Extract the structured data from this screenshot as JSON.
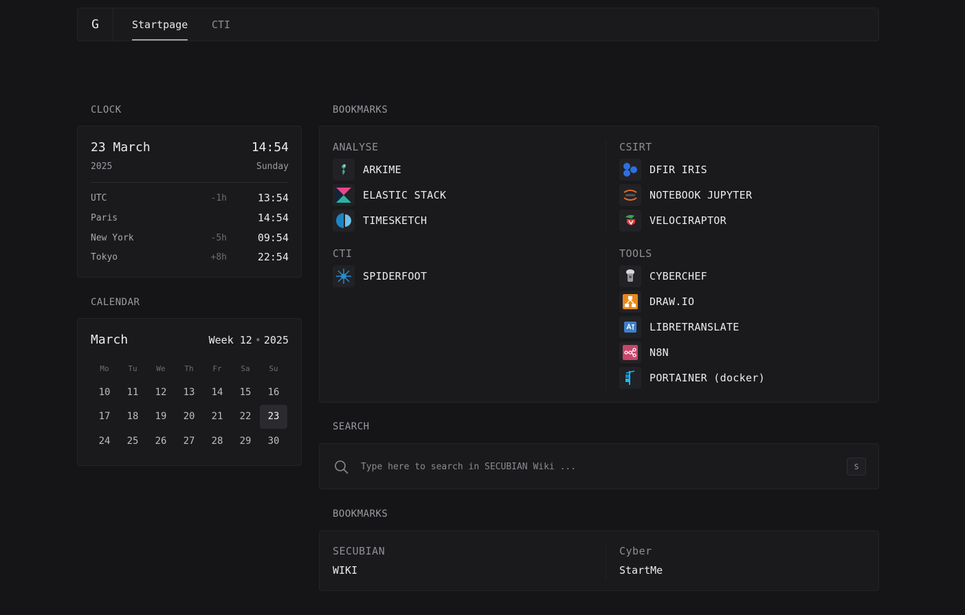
{
  "nav": {
    "logo": "G",
    "tabs": [
      {
        "label": "Startpage",
        "active": true
      },
      {
        "label": "CTI",
        "active": false
      }
    ]
  },
  "clock": {
    "title": "CLOCK",
    "date": "23 March",
    "time": "14:54",
    "year": "2025",
    "weekday": "Sunday",
    "zones": [
      {
        "name": "UTC",
        "offset": "-1h",
        "time": "13:54"
      },
      {
        "name": "Paris",
        "offset": "",
        "time": "14:54"
      },
      {
        "name": "New York",
        "offset": "-5h",
        "time": "09:54"
      },
      {
        "name": "Tokyo",
        "offset": "+8h",
        "time": "22:54"
      }
    ]
  },
  "calendar": {
    "title": "CALENDAR",
    "month": "March",
    "week_label": "Week 12",
    "dot": "•",
    "year": "2025",
    "weekdays": [
      "Mo",
      "Tu",
      "We",
      "Th",
      "Fr",
      "Sa",
      "Su"
    ],
    "weeks": [
      [
        "10",
        "11",
        "12",
        "13",
        "14",
        "15",
        "16"
      ],
      [
        "17",
        "18",
        "19",
        "20",
        "21",
        "22",
        "23"
      ],
      [
        "24",
        "25",
        "26",
        "27",
        "28",
        "29",
        "30"
      ]
    ],
    "today": "23"
  },
  "bookmarks": {
    "title": "BOOKMARKS",
    "groups": [
      {
        "title": "ANALYSE",
        "items": [
          {
            "label": "ARKIME",
            "icon": "arkime-icon"
          },
          {
            "label": "ELASTIC STACK",
            "icon": "elastic-icon"
          },
          {
            "label": "TIMESKETCH",
            "icon": "timesketch-icon"
          }
        ]
      },
      {
        "title": "CSIRT",
        "items": [
          {
            "label": "DFIR IRIS",
            "icon": "dfir-iris-icon"
          },
          {
            "label": "NOTEBOOK JUPYTER",
            "icon": "jupyter-icon"
          },
          {
            "label": "VELOCIRAPTOR",
            "icon": "velociraptor-icon"
          }
        ]
      },
      {
        "title": "CTI",
        "items": [
          {
            "label": "SPIDERFOOT",
            "icon": "spiderfoot-icon"
          }
        ]
      },
      {
        "title": "TOOLS",
        "items": [
          {
            "label": "CYBERCHEF",
            "icon": "cyberchef-icon"
          },
          {
            "label": "DRAW.IO",
            "icon": "drawio-icon"
          },
          {
            "label": "LIBRETRANSLATE",
            "icon": "libretranslate-icon"
          },
          {
            "label": "N8N",
            "icon": "n8n-icon"
          },
          {
            "label": "PORTAINER (docker)",
            "icon": "portainer-icon"
          }
        ]
      }
    ]
  },
  "search": {
    "title": "SEARCH",
    "placeholder": "Type here to search in SECUBIAN Wiki ...",
    "value": "",
    "shortcut": "S",
    "icon": "search-icon"
  },
  "bookmarks2": {
    "title": "BOOKMARKS",
    "groups": [
      {
        "title": "SECUBIAN",
        "items": [
          {
            "label": "WIKI"
          }
        ]
      },
      {
        "title": "Cyber",
        "items": [
          {
            "label": "StartMe"
          }
        ]
      }
    ]
  }
}
